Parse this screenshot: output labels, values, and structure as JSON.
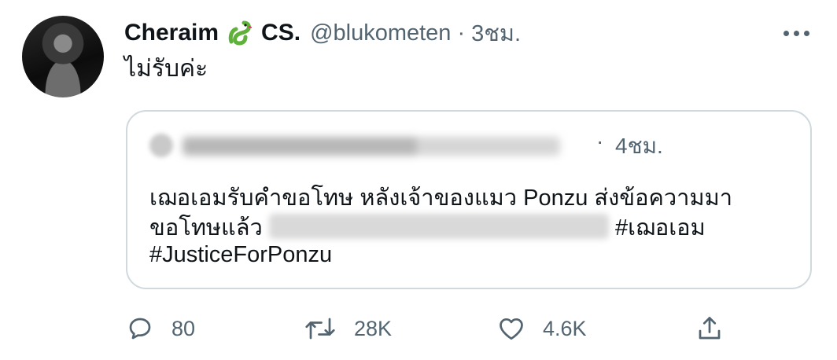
{
  "tweet": {
    "display_name": "Cheraim",
    "name_suffix": "CS.",
    "handle": "@blukometen",
    "separator": "·",
    "time": "3ชม.",
    "text": "ไม่รับค่ะ"
  },
  "quoted_tweet": {
    "separator": "·",
    "time": "4ชม.",
    "line1": "เฌอเอมรับคำขอโทษ หลังเจ้าของแมว Ponzu ส่งข้อความมา",
    "line2_prefix": "ขอโทษแล้ว",
    "hashtag1": "#เฌอเอม",
    "hashtag2": "#JusticeForPonzu"
  },
  "actions": {
    "replies": "80",
    "retweets": "28K",
    "likes": "4.6K"
  },
  "icons": {
    "avatar": "profile-photo",
    "name_emoji": "snake-icon",
    "more": "more-icon",
    "reply": "reply-icon",
    "retweet": "retweet-icon",
    "like": "heart-icon",
    "share": "share-icon"
  },
  "colors": {
    "text": "#0f1419",
    "secondary": "#536471",
    "border": "#cfd9de",
    "snake": "#5fb13a"
  }
}
